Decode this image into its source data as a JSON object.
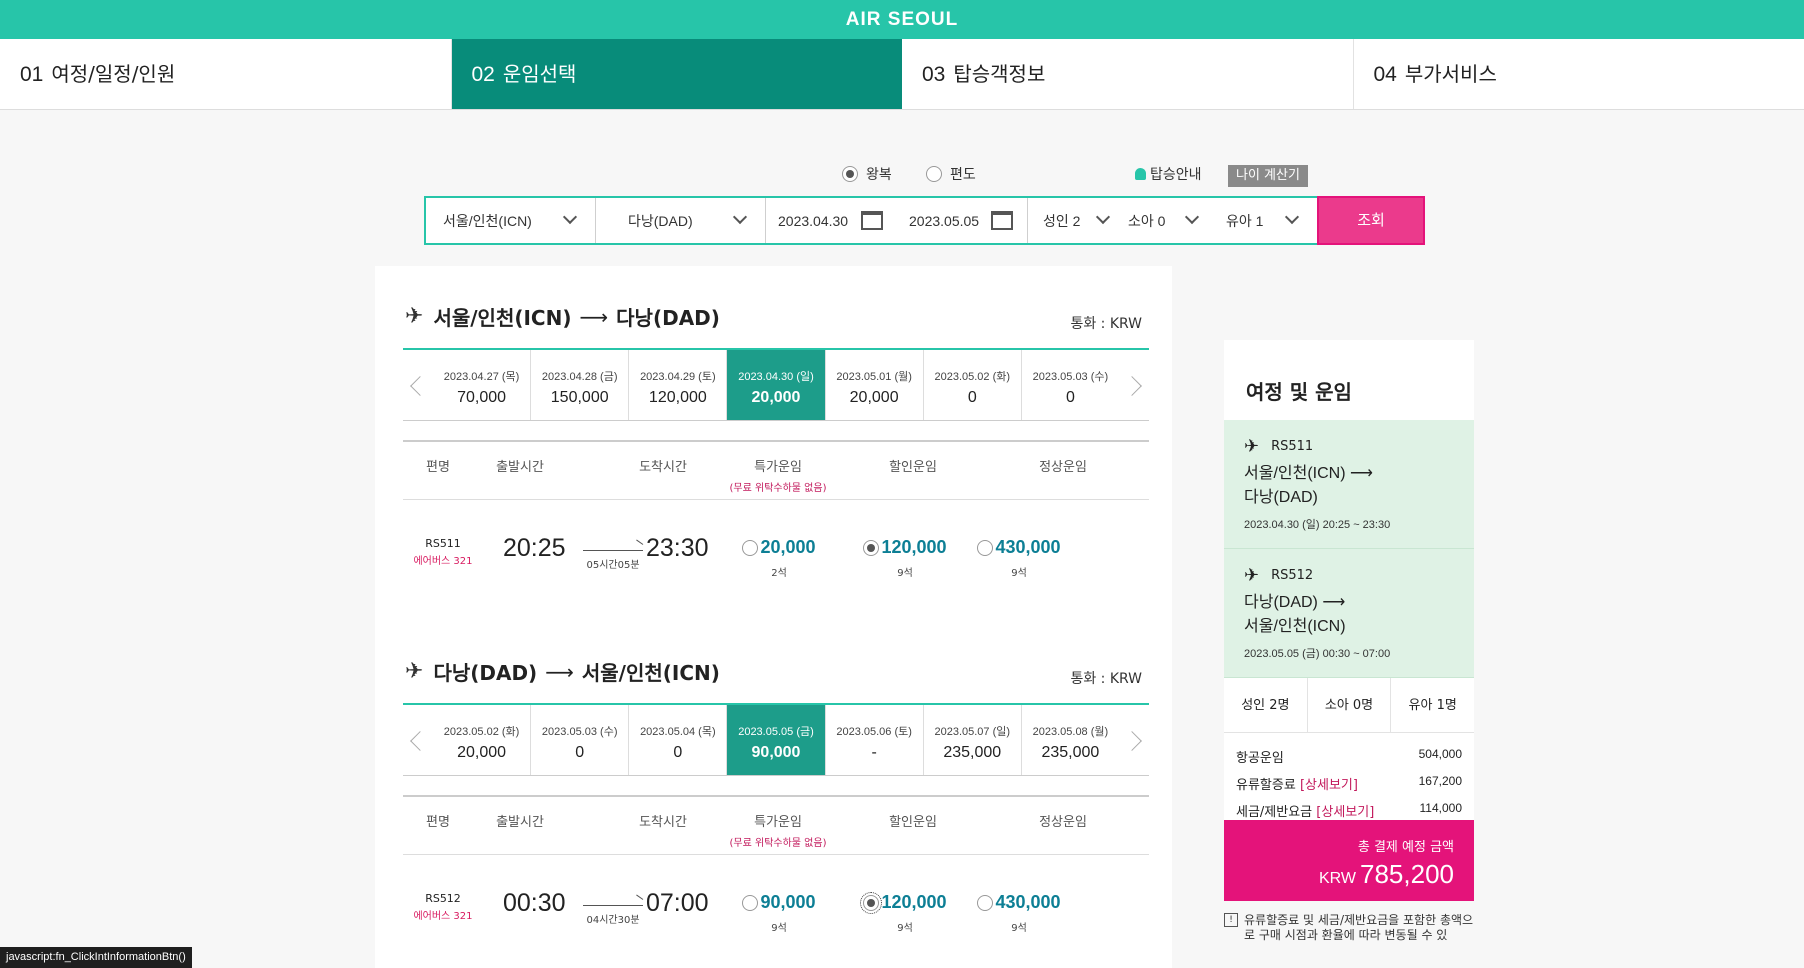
{
  "brand": {
    "logo": "AIR SEOUL"
  },
  "steps": [
    {
      "num": "01",
      "label": "여정/일정/인원"
    },
    {
      "num": "02",
      "label": "운임선택"
    },
    {
      "num": "03",
      "label": "탑승객정보"
    },
    {
      "num": "04",
      "label": "부가서비스"
    }
  ],
  "trip_type": {
    "round": "왕복",
    "oneway": "편도",
    "selected": "round"
  },
  "boarding_info": "탑승안내",
  "age_calc": "나이 계산기",
  "search": {
    "origin": "서울/인천(ICN)",
    "destination": "다낭(DAD)",
    "depart_date": "2023.04.30",
    "return_date": "2023.05.05",
    "adult": "성인 2",
    "child": "소아 0",
    "infant": "유아 1",
    "button": "조회"
  },
  "outbound": {
    "title_from": "서울/인천(ICN)",
    "title_to": "다낭(DAD)",
    "currency": "통화 : KRW",
    "dates": [
      {
        "d": "2023.04.27 (목)",
        "p": "70,000"
      },
      {
        "d": "2023.04.28 (금)",
        "p": "150,000"
      },
      {
        "d": "2023.04.29 (토)",
        "p": "120,000"
      },
      {
        "d": "2023.04.30 (일)",
        "p": "20,000"
      },
      {
        "d": "2023.05.01 (월)",
        "p": "20,000"
      },
      {
        "d": "2023.05.02 (화)",
        "p": "0"
      },
      {
        "d": "2023.05.03 (수)",
        "p": "0"
      }
    ],
    "selected_date_index": 3,
    "flight": {
      "no": "RS511",
      "aircraft": "에어버스 321",
      "dep": "20:25",
      "arr": "23:30",
      "duration": "05시간05분",
      "special": "20,000",
      "special_seats": "2석",
      "discount": "120,000",
      "discount_seats": "9석",
      "normal": "430,000",
      "normal_seats": "9석",
      "selected_fare": "discount"
    }
  },
  "inbound": {
    "title_from": "다낭(DAD)",
    "title_to": "서울/인천(ICN)",
    "currency": "통화 : KRW",
    "dates": [
      {
        "d": "2023.05.02 (화)",
        "p": "20,000"
      },
      {
        "d": "2023.05.03 (수)",
        "p": "0"
      },
      {
        "d": "2023.05.04 (목)",
        "p": "0"
      },
      {
        "d": "2023.05.05 (금)",
        "p": "90,000"
      },
      {
        "d": "2023.05.06 (토)",
        "p": "-"
      },
      {
        "d": "2023.05.07 (일)",
        "p": "235,000"
      },
      {
        "d": "2023.05.08 (월)",
        "p": "235,000"
      }
    ],
    "selected_date_index": 3,
    "flight": {
      "no": "RS512",
      "aircraft": "에어버스 321",
      "dep": "00:30",
      "arr": "07:00",
      "duration": "04시간30분",
      "special": "90,000",
      "special_seats": "9석",
      "discount": "120,000",
      "discount_seats": "9석",
      "normal": "430,000",
      "normal_seats": "9석",
      "selected_fare": "discount"
    }
  },
  "table_headers": {
    "flight": "편명",
    "dep": "출발시간",
    "arr": "도착시간",
    "special": "특가운임",
    "special_note": "(무료 위탁수하물 없음)",
    "discount": "할인운임",
    "normal": "정상운임"
  },
  "summary": {
    "title": "여정 및 운임",
    "legs": [
      {
        "fn": "RS511",
        "route": "서울/인천(ICN) ⟶",
        "route2": "다낭(DAD)",
        "time": "2023.04.30 (일) 20:25 ~ 23:30"
      },
      {
        "fn": "RS512",
        "route": "다낭(DAD) ⟶",
        "route2": "서울/인천(ICN)",
        "time": "2023.05.05 (금) 00:30 ~ 07:00"
      }
    ],
    "pax": [
      "성인 2명",
      "소아 0명",
      "유아 1명"
    ],
    "costs": [
      {
        "label": "항공운임",
        "detail": "",
        "amount": "504,000"
      },
      {
        "label": "유류할증료",
        "detail": "[상세보기]",
        "amount": "167,200"
      },
      {
        "label": "세금/제반요금",
        "detail": "[상세보기]",
        "amount": "114,000"
      }
    ],
    "total_label": "총 결제 예정 금액",
    "total_currency": "KRW",
    "total_amount": "785,200",
    "note": "유류할증료 및 세금/제반요금을 포함한 총액으로 구매 시점과 환율에 따라 변동될 수 있"
  },
  "status_url": "javascript:fn_ClickIntInformationBtn()",
  "colors": {
    "brand": "#27c5a9",
    "active_step": "#088c7a",
    "accent": "#e4137a",
    "fare_text": "#0d7f95"
  }
}
